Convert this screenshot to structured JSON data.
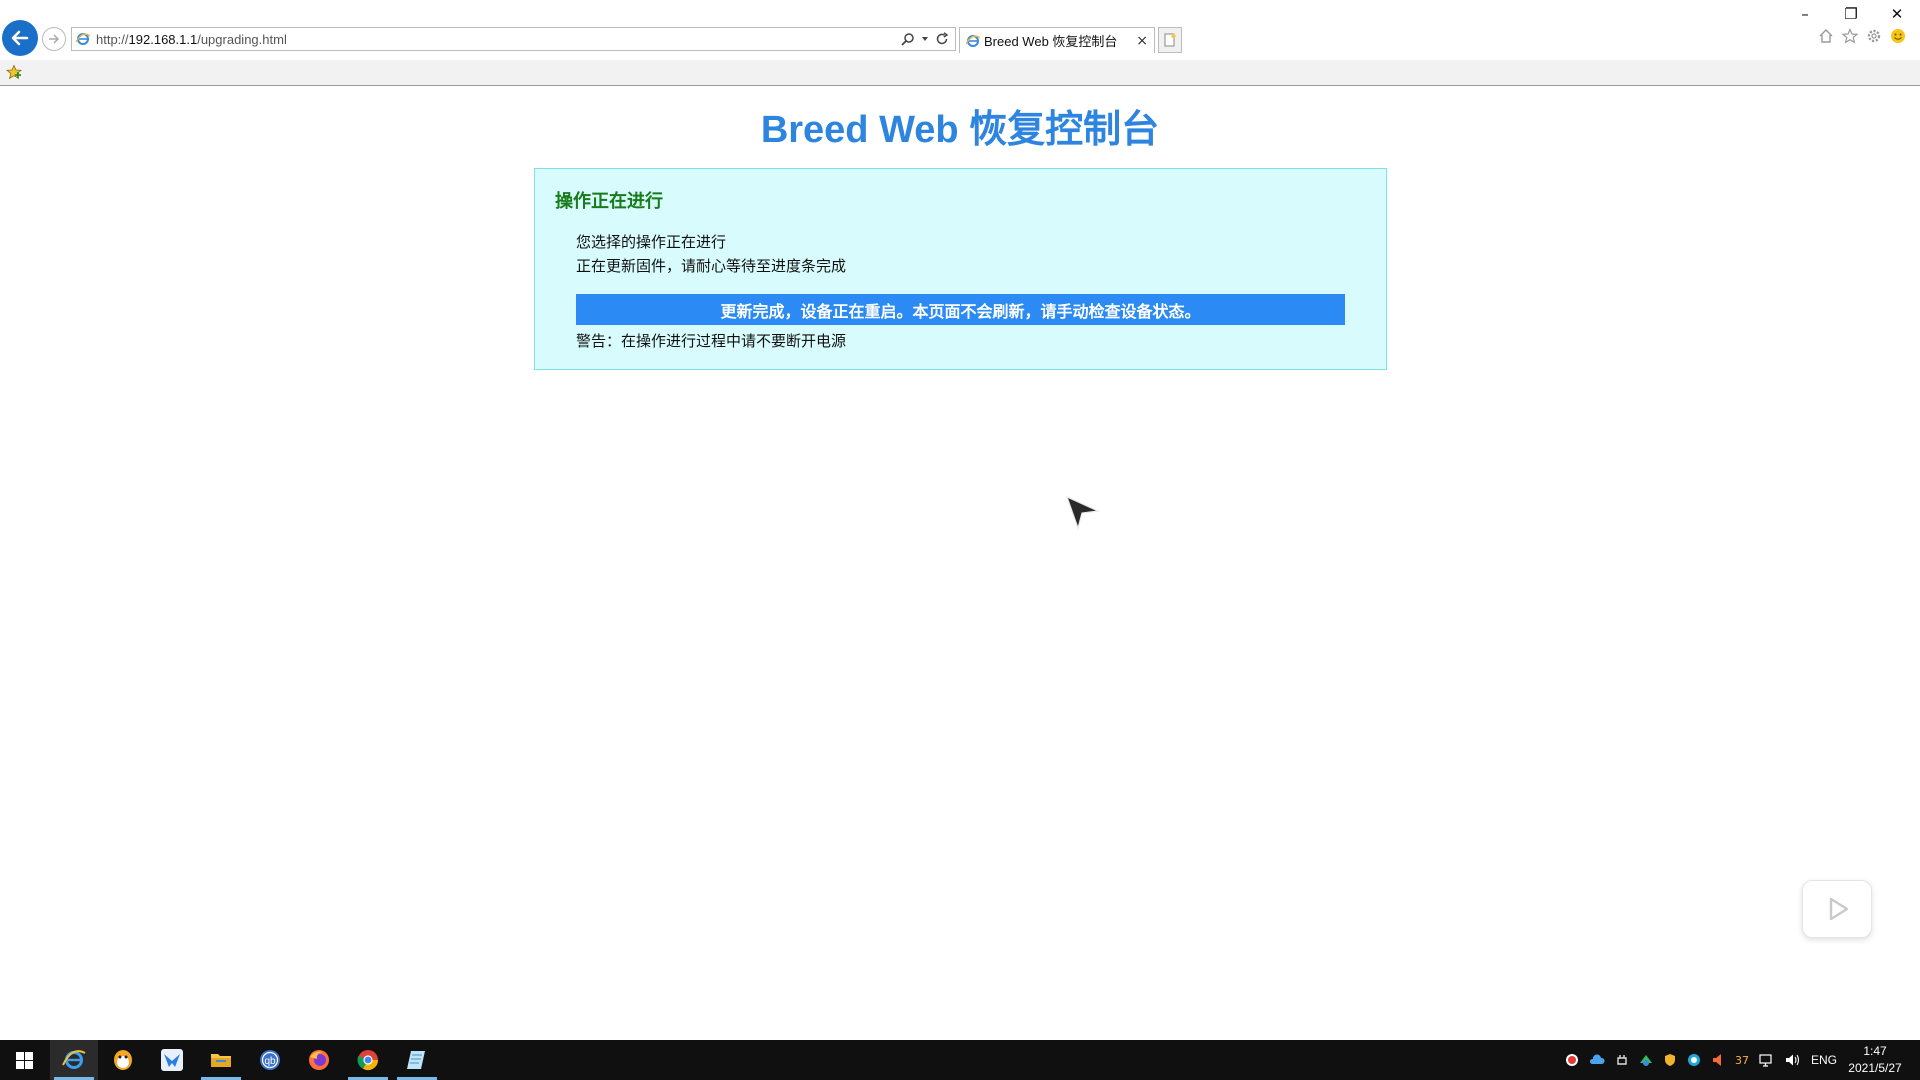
{
  "browser": {
    "url": "http://192.168.1.1/upgrading.html",
    "url_scheme": "http://",
    "url_host": "192.168.1.1",
    "url_path": "/upgrading.html",
    "tab_title": "Breed Web 恢复控制台",
    "tab_close": "×",
    "window_controls": {
      "minimize": "–",
      "restore": "❐",
      "close": "✕"
    }
  },
  "page": {
    "title": "Breed Web 恢复控制台",
    "panel": {
      "heading": "操作正在进行",
      "line1": "您选择的操作正在进行",
      "line2": "正在更新固件，请耐心等待至进度条完成",
      "progress_text": "更新完成，设备正在重启。本页面不会刷新，请手动检查设备状态。",
      "warning": "警告：在操作进行过程中请不要断开电源"
    }
  },
  "taskbar": {
    "apps": [
      "internet-explorer",
      "qq",
      "xunlei",
      "file-explorer",
      "qbittorrent",
      "firefox",
      "chrome",
      "notepad"
    ],
    "tray": {
      "badge_count": "37",
      "language": "ENG",
      "time": "1:47",
      "date": "2021/5/27"
    }
  },
  "colors": {
    "title": "#2e85e0",
    "panel_bg": "#d8fcfd",
    "panel_border": "#81e0e6",
    "heading": "#177a1b",
    "progress_bar": "#2b8af4"
  }
}
